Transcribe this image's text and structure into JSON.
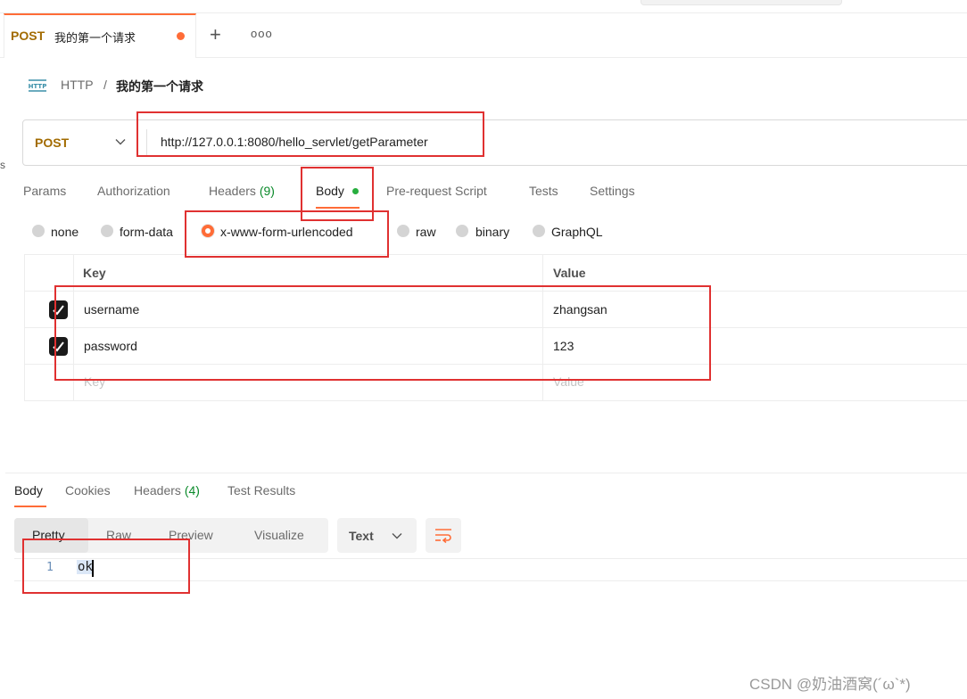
{
  "tab": {
    "method": "POST",
    "name": "我的第一个请求",
    "plus": "+",
    "more": "ooo"
  },
  "breadcrumb": {
    "icon_label": "HTTP",
    "root": "HTTP",
    "separator": "/",
    "current": "我的第一个请求"
  },
  "request": {
    "method": "POST",
    "url": "http://127.0.0.1:8080/hello_servlet/getParameter"
  },
  "request_tabs": [
    {
      "label": "Params"
    },
    {
      "label": "Authorization"
    },
    {
      "label": "Headers",
      "count": "(9)"
    },
    {
      "label": "Body"
    },
    {
      "label": "Pre-request Script"
    },
    {
      "label": "Tests"
    },
    {
      "label": "Settings"
    }
  ],
  "body_types": [
    {
      "label": "none",
      "selected": false
    },
    {
      "label": "form-data",
      "selected": false
    },
    {
      "label": "x-www-form-urlencoded",
      "selected": true
    },
    {
      "label": "raw",
      "selected": false
    },
    {
      "label": "binary",
      "selected": false
    },
    {
      "label": "GraphQL",
      "selected": false
    }
  ],
  "kv_table": {
    "headers": {
      "key": "Key",
      "value": "Value"
    },
    "rows": [
      {
        "key": "username",
        "value": "zhangsan",
        "checked": true
      },
      {
        "key": "password",
        "value": "123",
        "checked": true
      }
    ],
    "placeholder": {
      "key": "Key",
      "value": "Value"
    }
  },
  "response_tabs": [
    {
      "label": "Body"
    },
    {
      "label": "Cookies"
    },
    {
      "label": "Headers",
      "count": "(4)"
    },
    {
      "label": "Test Results"
    }
  ],
  "format_buttons": [
    "Pretty",
    "Raw",
    "Preview",
    "Visualize"
  ],
  "format_type": "Text",
  "editor": {
    "line_number": "1",
    "content": "ok"
  },
  "watermark": "CSDN @奶油酒窝(´ω`*)",
  "left_edge_char": "s",
  "colors": {
    "accent": "#ff6c37",
    "post_method": "#a26b00",
    "annotation_red": "#e03131",
    "count_green": "#0a8a2a"
  }
}
